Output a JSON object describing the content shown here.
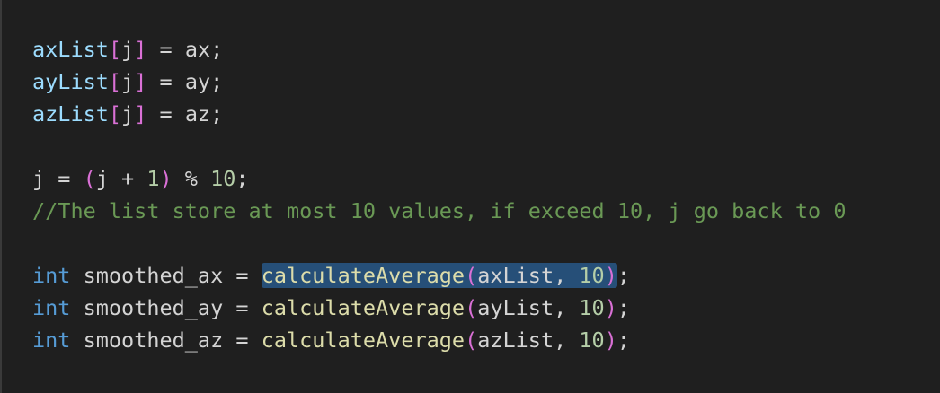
{
  "editor": {
    "lines": [
      {
        "tokens": [
          {
            "t": "var",
            "v": "axList"
          },
          {
            "t": "br1",
            "v": "["
          },
          {
            "t": "plain",
            "v": "j"
          },
          {
            "t": "br1",
            "v": "]"
          },
          {
            "t": "op",
            "v": " = "
          },
          {
            "t": "plain",
            "v": "ax;"
          }
        ]
      },
      {
        "tokens": [
          {
            "t": "var",
            "v": "ayList"
          },
          {
            "t": "br1",
            "v": "["
          },
          {
            "t": "plain",
            "v": "j"
          },
          {
            "t": "br1",
            "v": "]"
          },
          {
            "t": "op",
            "v": " = "
          },
          {
            "t": "plain",
            "v": "ay;"
          }
        ]
      },
      {
        "tokens": [
          {
            "t": "var",
            "v": "azList"
          },
          {
            "t": "br1",
            "v": "["
          },
          {
            "t": "plain",
            "v": "j"
          },
          {
            "t": "br1",
            "v": "]"
          },
          {
            "t": "op",
            "v": " = "
          },
          {
            "t": "plain",
            "v": "az;"
          }
        ]
      },
      {
        "tokens": []
      },
      {
        "tokens": [
          {
            "t": "plain",
            "v": "j = "
          },
          {
            "t": "br1",
            "v": "("
          },
          {
            "t": "plain",
            "v": "j + "
          },
          {
            "t": "num",
            "v": "1"
          },
          {
            "t": "br1",
            "v": ")"
          },
          {
            "t": "plain",
            "v": " % "
          },
          {
            "t": "num",
            "v": "10"
          },
          {
            "t": "plain",
            "v": ";"
          }
        ]
      },
      {
        "tokens": [
          {
            "t": "cmt",
            "v": "//The list store at most 10 values, if exceed 10, j go back to 0"
          }
        ]
      },
      {
        "tokens": []
      },
      {
        "tokens": [
          {
            "t": "kw",
            "v": "int"
          },
          {
            "t": "plain",
            "v": " smoothed_ax = "
          },
          {
            "t": "fn",
            "v": "calculateAverage",
            "sel": true
          },
          {
            "t": "br1",
            "v": "(",
            "sel": true
          },
          {
            "t": "plain",
            "v": "axList, ",
            "sel": true
          },
          {
            "t": "num",
            "v": "10",
            "sel": true
          },
          {
            "t": "br1",
            "v": ")",
            "sel": true
          },
          {
            "t": "plain",
            "v": ";"
          }
        ]
      },
      {
        "tokens": [
          {
            "t": "kw",
            "v": "int"
          },
          {
            "t": "plain",
            "v": " smoothed_ay = "
          },
          {
            "t": "fn",
            "v": "calculateAverage"
          },
          {
            "t": "br1",
            "v": "("
          },
          {
            "t": "plain",
            "v": "ayList, "
          },
          {
            "t": "num",
            "v": "10"
          },
          {
            "t": "br1",
            "v": ")"
          },
          {
            "t": "plain",
            "v": ";"
          }
        ]
      },
      {
        "tokens": [
          {
            "t": "kw",
            "v": "int"
          },
          {
            "t": "plain",
            "v": " smoothed_az = "
          },
          {
            "t": "fn",
            "v": "calculateAverage"
          },
          {
            "t": "br1",
            "v": "("
          },
          {
            "t": "plain",
            "v": "azList, "
          },
          {
            "t": "num",
            "v": "10"
          },
          {
            "t": "br1",
            "v": ")"
          },
          {
            "t": "plain",
            "v": ";"
          }
        ]
      }
    ]
  },
  "colors": {
    "background": "#1f1f1f",
    "selection": "#264f78"
  }
}
